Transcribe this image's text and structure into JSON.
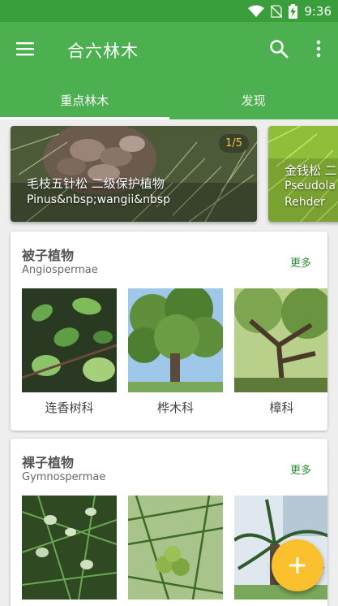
{
  "status_bar": {
    "time": "9:36",
    "icons": [
      "wifi-icon",
      "sim-off-icon",
      "battery-charging-icon"
    ]
  },
  "app_bar": {
    "title": "合六林木",
    "icons": [
      "menu-icon",
      "search-icon",
      "more-vert-icon"
    ]
  },
  "tabs": [
    {
      "label": "重点林木",
      "active": true
    },
    {
      "label": "发现",
      "active": false
    }
  ],
  "carousel": {
    "counter": "1/5",
    "slides": [
      {
        "title": "毛枝五针松  二级保护植物",
        "latin": "Pinus&nbsp;wangii&nbsp"
      },
      {
        "title": "金钱松  二",
        "latin": "Pseudola",
        "latin2": "Rehder"
      }
    ]
  },
  "sections": [
    {
      "title": "被子植物",
      "subtitle": "Angiospermae",
      "more": "更多",
      "items": [
        {
          "label": "连香树科"
        },
        {
          "label": "桦木科"
        },
        {
          "label": "樟科"
        }
      ]
    },
    {
      "title": "裸子植物",
      "subtitle": "Gymnospermae",
      "more": "更多",
      "items": [
        {
          "label": ""
        },
        {
          "label": ""
        },
        {
          "label": ""
        }
      ]
    }
  ],
  "fab": {
    "icon": "plus-icon"
  },
  "colors": {
    "primary": "#4caf50",
    "status_bar": "#3b9e3d",
    "accent": "#fbc02d",
    "more_link": "#2e8b3a",
    "counter_text": "#f5c242"
  }
}
